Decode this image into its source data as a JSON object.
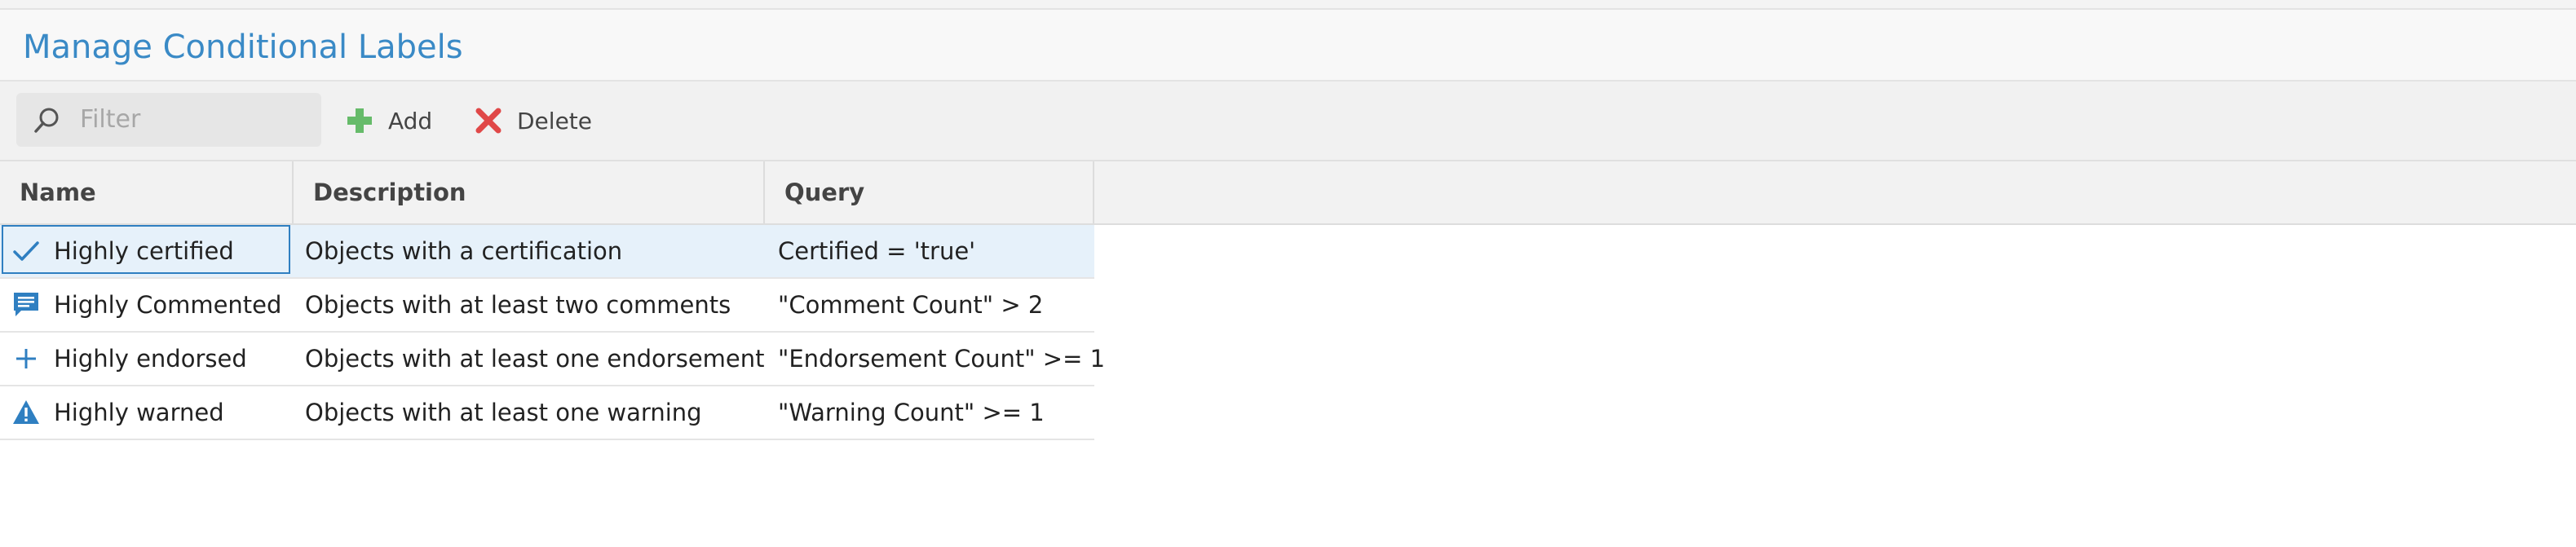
{
  "header": {
    "title": "Manage Conditional Labels"
  },
  "toolbar": {
    "filter_placeholder": "Filter",
    "add_label": "Add",
    "delete_label": "Delete",
    "search_icon": "search-icon",
    "add_icon": "plus-icon",
    "delete_icon": "close-icon",
    "add_icon_color": "#66bb6a",
    "delete_icon_color": "#e04848"
  },
  "table": {
    "columns": [
      "Name",
      "Description",
      "Query"
    ],
    "rows": [
      {
        "icon": "checkmark-icon",
        "name": "Highly certified",
        "description": "Objects with a certification",
        "query": "Certified = 'true'",
        "selected": true
      },
      {
        "icon": "comment-icon",
        "name": "Highly Commented",
        "description": "Objects with at least two comments",
        "query": "\"Comment Count\" > 2",
        "selected": false
      },
      {
        "icon": "plus-icon",
        "name": "Highly endorsed",
        "description": "Objects with at least one endorsement",
        "query": "\"Endorsement Count\" >= 1",
        "selected": false
      },
      {
        "icon": "warning-icon",
        "name": "Highly warned",
        "description": "Objects with at least one warning",
        "query": "\"Warning Count\" >= 1",
        "selected": false
      }
    ]
  },
  "colors": {
    "accent": "#3a8ac6",
    "selected_row": "#e6f1fa",
    "selection_border": "#2f7fc1",
    "icon_blue": "#2f7fc1"
  }
}
